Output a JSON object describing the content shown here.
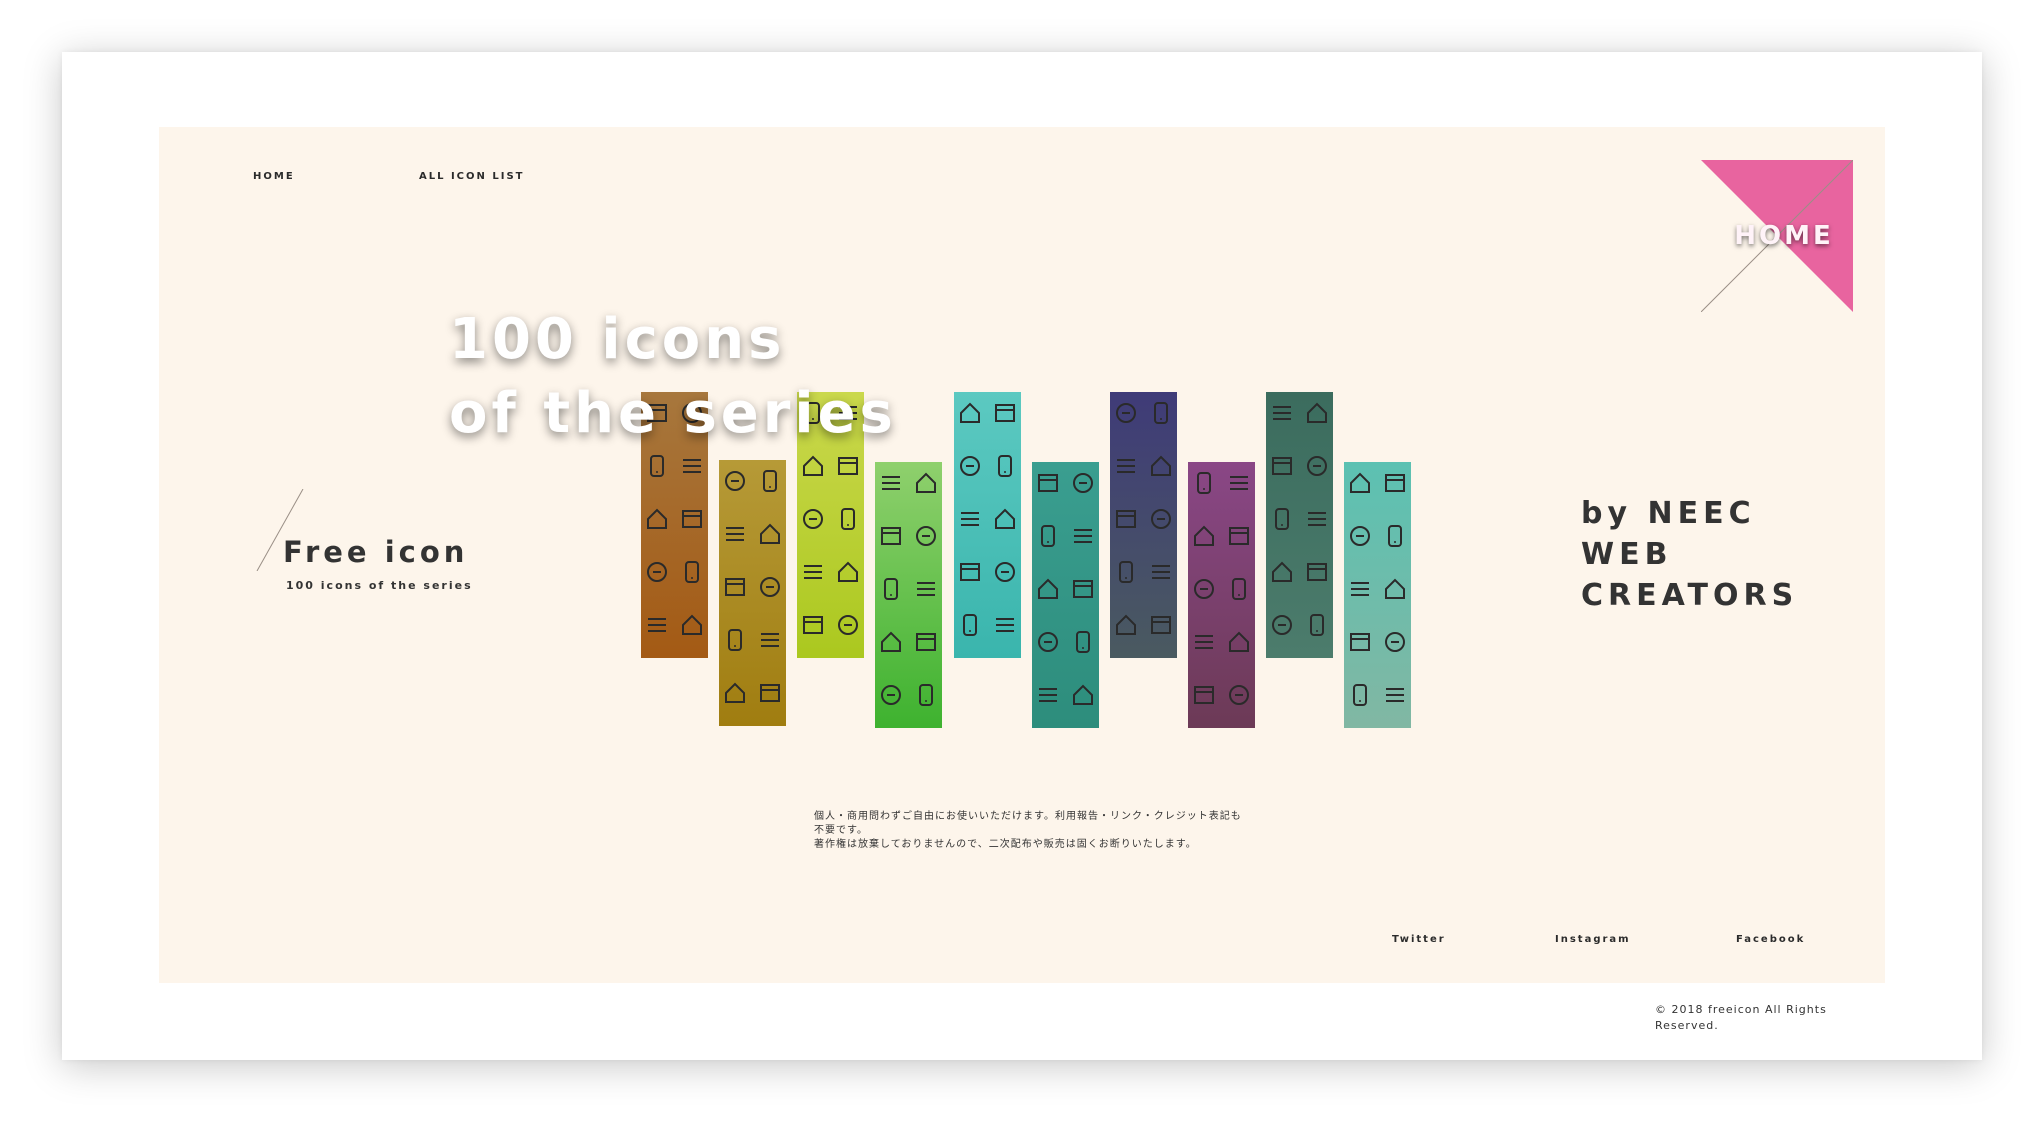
{
  "nav": {
    "home": "HOME",
    "all_icon_list": "ALL ICON LIST"
  },
  "corner": {
    "label": "HOME",
    "color": "#e8649f"
  },
  "hero": {
    "title_line1": "100 icons",
    "title_line2": "of the series"
  },
  "intro": {
    "title": "Free icon",
    "subtitle": "100 icons of the series"
  },
  "credit": {
    "line1": "by NEEC",
    "line2": "WEB",
    "line3": "CREATORS"
  },
  "icon_columns": [
    {
      "color_top": "#a7773d",
      "color_bottom": "#a45a14",
      "icons": [
        "mail-icon",
        "zoom-in-icon",
        "tablet-icon",
        "tag-icon",
        "pause-icon",
        "download-icon",
        "rewind-icon",
        "close-circle-icon",
        "book-icon",
        "folder-icon"
      ]
    },
    {
      "color_top": "#b69a37",
      "color_bottom": "#a07d10",
      "icons": [
        "previous-icon",
        "volume-icon",
        "close-icon",
        "no-entry-icon",
        "cloud-upload-icon",
        "folder-icon",
        "rss-icon",
        "menu-icon",
        "music-icon",
        "flag-icon"
      ]
    },
    {
      "color_top": "#cad84c",
      "color_bottom": "#abc81f",
      "icons": [
        "battery-icon",
        "add-box-icon",
        "bluetooth-icon",
        "power-icon",
        "magnet-icon",
        "medical-cross-icon",
        "phone-icon",
        "wifi-tower-icon",
        "card-icon",
        "monitor-icon"
      ]
    },
    {
      "color_top": "#8fd06d",
      "color_bottom": "#3eb22f",
      "icons": [
        "save-icon",
        "save-icon",
        "trash-icon",
        "download-box-icon",
        "mail-icon",
        "smile-icon",
        "chat-icon",
        "play-icon",
        "check-icon",
        "palette-icon"
      ]
    },
    {
      "color_top": "#5cc9c1",
      "color_bottom": "#3ab5ad",
      "icons": [
        "home-icon",
        "arrow-right-icon",
        "recycle-icon",
        "list-icon",
        "transfer-icon",
        "folder-icon",
        "reply-icon",
        "chip-icon",
        "sort-icon",
        "list-icon"
      ]
    },
    {
      "color_top": "#3a9e90",
      "color_bottom": "#2d8d7c",
      "icons": [
        "play-circle-icon",
        "pause-circle-icon",
        "hat-icon",
        "heart-icon",
        "magic-wand-icon",
        "bird-icon",
        "thumbs-down-icon",
        "phone-icon",
        "magic-hat-icon",
        "tophat-icon"
      ]
    },
    {
      "color_top": "#3f3b78",
      "color_bottom": "#4a5a60",
      "icons": [
        "zoom-icon",
        "zoom-icon",
        "cart-icon",
        "cart-add-icon",
        "check-box-icon",
        "calendar-icon",
        "map-pin-icon",
        "tag-icon",
        "gamepad-icon",
        "disc-icon"
      ]
    },
    {
      "color_top": "#8a4786",
      "color_bottom": "#6c3a56",
      "icons": [
        "chart-icon",
        "square-icon",
        "chart-icon",
        "chart-icon",
        "image-icon",
        "cloud-upload-icon",
        "browser-icon",
        "books-icon",
        "stack-icon",
        "laptop-icon"
      ]
    },
    {
      "color_top": "#3b6c5e",
      "color_bottom": "#4c7c6c",
      "icons": [
        "camera-icon",
        "camera-icon",
        "search-icon",
        "search-icon",
        "castle-icon",
        "puzzle-icon",
        "train-icon",
        "browser-icon",
        "ban-icon",
        "video-icon"
      ]
    },
    {
      "color_top": "#5cc1b2",
      "color_bottom": "#81b7a3",
      "icons": [
        "home-icon",
        "contrast-icon",
        "comment-icon",
        "id-card-icon",
        "cloud-icon",
        "lock-icon",
        "warning-icon",
        "badge-icon",
        "phone-handset-icon",
        "settings-icon"
      ]
    }
  ],
  "notice": {
    "line1": "個人・商用問わずご自由にお使いいただけます。利用報告・リンク・クレジット表記も",
    "line2": "不要です。",
    "line3": "著作権は放棄しておりませんので、二次配布や販売は固くお断りいたします。"
  },
  "social": {
    "twitter": "Twitter",
    "instagram": "Instagram",
    "facebook": "Facebook"
  },
  "footer": {
    "copyright": "© 2018 freeicon All Rights Reserved."
  }
}
